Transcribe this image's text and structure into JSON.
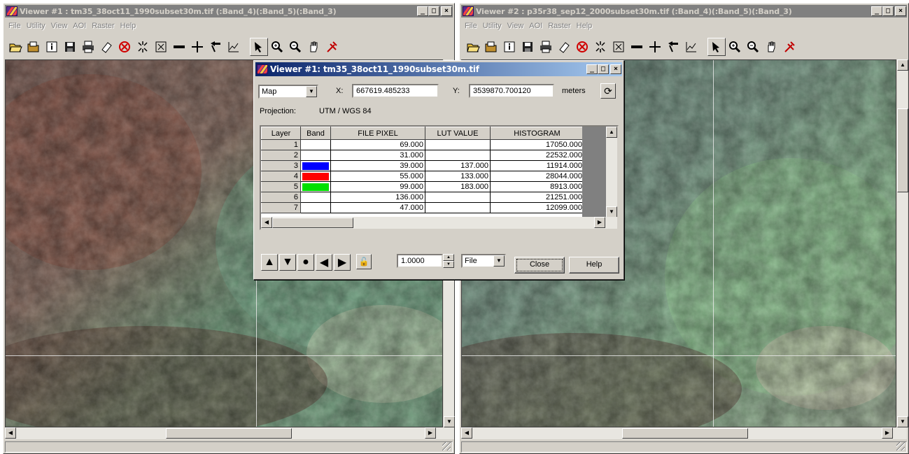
{
  "viewer1": {
    "title": "Viewer #1 : tm35_38oct11_1990subset30m.tif (:Band_4)(:Band_5)(:Band_3)",
    "menu": [
      "File",
      "Utility",
      "View",
      "AOI",
      "Raster",
      "Help"
    ]
  },
  "viewer2": {
    "title": "Viewer #2 : p35r38_sep12_2000subset30m.tif (:Band_4)(:Band_5)(:Band_3)",
    "menu": [
      "File",
      "Utility",
      "View",
      "AOI",
      "Raster",
      "Help"
    ]
  },
  "window_buttons": {
    "minimize": "_",
    "maximize": "□",
    "close": "×"
  },
  "toolbar_icons": [
    "open-icon",
    "open-raster-icon",
    "info-icon",
    "save-icon",
    "print-icon",
    "eraser-icon",
    "stop-icon",
    "zoom-fit-icon",
    "zoom-extent-icon",
    "measure-ruler-icon",
    "crosshair-icon",
    "arrow-tool-icon",
    "profile-icon",
    "select-pointer-icon",
    "zoom-in-icon",
    "zoom-out-icon",
    "pan-hand-icon",
    "inquire-icon"
  ],
  "inquire": {
    "title": "Viewer #1:  tm35_38oct11_1990subset30m.tif",
    "coord_type": "Map",
    "x_label": "X:",
    "x_value": "667619.485233",
    "y_label": "Y:",
    "y_value": "3539870.700120",
    "units": "meters",
    "projection_label": "Projection:",
    "projection_value": "UTM / WGS 84",
    "columns": [
      "Layer",
      "Band",
      "FILE PIXEL",
      "LUT VALUE",
      "HISTOGRAM"
    ],
    "rows": [
      {
        "layer": "1",
        "band_color": "",
        "file_pixel": "69.000",
        "lut": "",
        "hist": "17050.000"
      },
      {
        "layer": "2",
        "band_color": "",
        "file_pixel": "31.000",
        "lut": "",
        "hist": "22532.000"
      },
      {
        "layer": "3",
        "band_color": "#0000ff",
        "file_pixel": "39.000",
        "lut": "137.000",
        "hist": "11914.000"
      },
      {
        "layer": "4",
        "band_color": "#ff0000",
        "file_pixel": "55.000",
        "lut": "133.000",
        "hist": "28044.000"
      },
      {
        "layer": "5",
        "band_color": "#00e000",
        "file_pixel": "99.000",
        "lut": "183.000",
        "hist": "8913.000"
      },
      {
        "layer": "6",
        "band_color": "",
        "file_pixel": "136.000",
        "lut": "",
        "hist": "21251.000"
      },
      {
        "layer": "7",
        "band_color": "",
        "file_pixel": "47.000",
        "lut": "",
        "hist": "12099.000"
      }
    ],
    "step_value": "1.0000",
    "source": "File",
    "close_label": "Close",
    "help_label": "Help"
  }
}
